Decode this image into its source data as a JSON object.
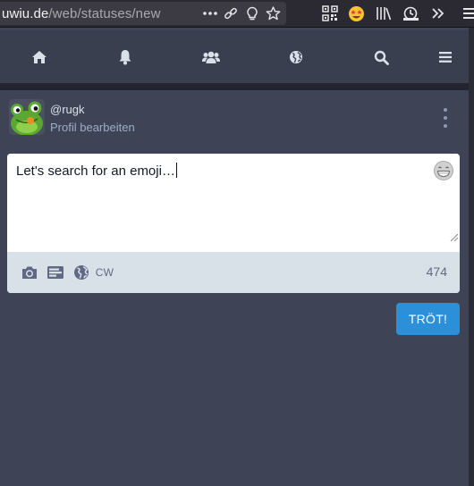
{
  "browser": {
    "url_domain": "uwiu.de",
    "url_path": "/web/statuses/new",
    "urlbar_icons": [
      "more-dots-icon",
      "link-icon",
      "lightbulb-icon",
      "star-icon"
    ],
    "toolbar_icons": [
      "qr-code-icon",
      "star-struck-emoji-icon",
      "library-icon",
      "screenshot-icon",
      "overflow-chevron-icon"
    ]
  },
  "nav": {
    "items": [
      {
        "name": "home",
        "icon": "home-icon"
      },
      {
        "name": "notifications",
        "icon": "bell-icon"
      },
      {
        "name": "local",
        "icon": "users-icon"
      },
      {
        "name": "federated",
        "icon": "globe-icon"
      },
      {
        "name": "search",
        "icon": "search-icon"
      },
      {
        "name": "menu",
        "icon": "hamburger-icon"
      }
    ]
  },
  "account": {
    "handle": "@rugk",
    "edit_profile": "Profil bearbeiten",
    "avatar": "frog-avatar"
  },
  "compose": {
    "text": "Let's search for an emoji…",
    "char_count": "474",
    "cw_label": "CW",
    "toot_label": "TRÖT!",
    "emoji_button": "grinning-emoji-icon"
  },
  "colors": {
    "background": "#3e4455",
    "nav": "#393f4f",
    "accent": "#2b90d9",
    "compose_footer": "#d9e1e8"
  }
}
